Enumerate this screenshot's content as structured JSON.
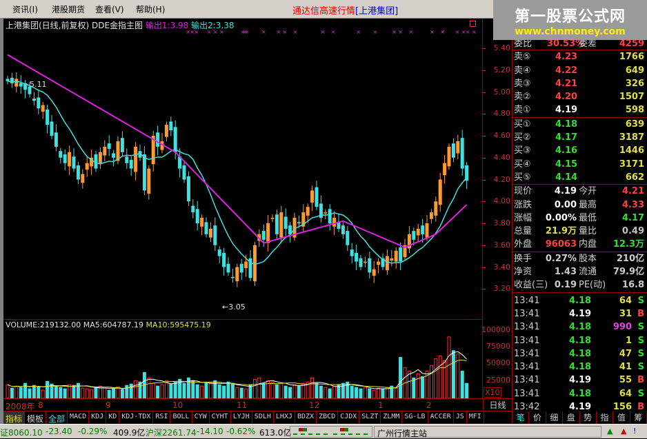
{
  "menu": {
    "items": [
      "资讯(I)",
      "港股期货",
      "查看(V)",
      "帮助(H)"
    ],
    "title": "通达信高速行情",
    "title_stock": "[上港集团]"
  },
  "logo": {
    "name": "第一股票公式网",
    "url": "www.chnmoney.com"
  },
  "chart_header": {
    "title": "上港集团(日线,前复权) DDE金指主图",
    "out1": "输出1:3.98",
    "out2": "输出2:3.38"
  },
  "annotations": {
    "high": "5.11",
    "low": "←3.05"
  },
  "volume_header": {
    "volume": "VOLUME:219132.00",
    "ma5": "MA5:604787.19",
    "ma10": "MA10:595475.19"
  },
  "volume_axis": [
    "100000",
    "75000",
    "50000",
    "25000"
  ],
  "volume_unit": "X10",
  "period": "日线",
  "date_labels": [
    "2008年",
    "8",
    "9",
    "10",
    "11",
    "12",
    "1",
    "2"
  ],
  "tabs": [
    "指标",
    "模板",
    "全部",
    "MACD",
    "KDJ",
    "KD",
    "KDJ-TDX",
    "RSI",
    "BOLL",
    "CYW",
    "CYHT",
    "LYJH",
    "SDLH",
    "LHXJ",
    "BDZX",
    "ZBCD",
    "CJDX",
    "SLZT",
    "ZLMM",
    "SG-LB",
    "ACCER",
    "JS",
    "MFI"
  ],
  "quote": {
    "wb": {
      "label": "委比",
      "value": "30.53%",
      "label2": "委差",
      "value2": "4259"
    },
    "sells": [
      {
        "label": "卖⑤",
        "price": "4.23",
        "vol": "1766"
      },
      {
        "label": "卖④",
        "price": "4.22",
        "vol": "649"
      },
      {
        "label": "卖③",
        "price": "4.21",
        "vol": "326"
      },
      {
        "label": "卖②",
        "price": "4.20",
        "vol": "1507"
      },
      {
        "label": "卖①",
        "price": "4.19",
        "vol": "598"
      }
    ],
    "buys": [
      {
        "label": "买①",
        "price": "4.18",
        "vol": "639"
      },
      {
        "label": "买②",
        "price": "4.17",
        "vol": "3187"
      },
      {
        "label": "买③",
        "price": "4.16",
        "vol": "1446"
      },
      {
        "label": "买④",
        "price": "4.15",
        "vol": "3171"
      },
      {
        "label": "买⑤",
        "price": "4.14",
        "vol": "662"
      }
    ],
    "stats": [
      {
        "l1": "现价",
        "v1": "4.19",
        "c1": "#ffffff",
        "l2": "今开",
        "v2": "4.21",
        "c2": "#ff4040"
      },
      {
        "l1": "涨跌",
        "v1": "0.00",
        "c1": "#ffffff",
        "l2": "最高",
        "v2": "4.33",
        "c2": "#ff4040"
      },
      {
        "l1": "涨幅",
        "v1": "0.00%",
        "c1": "#ffffff",
        "l2": "最低",
        "v2": "4.17",
        "c2": "#30e030"
      },
      {
        "l1": "总量",
        "v1": "21.9万",
        "c1": "#e0e040",
        "l2": "量比",
        "v2": "0.49",
        "c2": "#c0c0c0"
      },
      {
        "l1": "外盘",
        "v1": "96063",
        "c1": "#ff4040",
        "l2": "内盘",
        "v2": "12.3万",
        "c2": "#30e030"
      }
    ],
    "stats2": [
      {
        "l1": "换手",
        "v1": "0.27%",
        "l2": "股本",
        "v2": "210亿"
      },
      {
        "l1": "净资",
        "v1": "1.43",
        "l2": "流通",
        "v2": "79.9亿"
      },
      {
        "l1": "收益(三)",
        "v1": "0.19",
        "l2": "PE(动)",
        "v2": "16.8"
      }
    ]
  },
  "ticks": [
    {
      "time": "13:41",
      "price": "4.18",
      "vol": "64",
      "bs": "S",
      "pc": "#30e030",
      "vc": "#e0e040"
    },
    {
      "time": "13:41",
      "price": "4.19",
      "vol": "31",
      "bs": "B",
      "pc": "#ffffff",
      "vc": "#e0e040"
    },
    {
      "time": "13:41",
      "price": "4.18",
      "vol": "990",
      "bs": "S",
      "pc": "#30e030",
      "vc": "#e040e0"
    },
    {
      "time": "13:41",
      "price": "4.18",
      "vol": "1",
      "bs": "S",
      "pc": "#30e030",
      "vc": "#e0e040"
    },
    {
      "time": "13:41",
      "price": "4.18",
      "vol": "47",
      "bs": "S",
      "pc": "#30e030",
      "vc": "#e0e040"
    },
    {
      "time": "13:41",
      "price": "4.18",
      "vol": "41",
      "bs": "S",
      "pc": "#30e030",
      "vc": "#e0e040"
    },
    {
      "time": "13:41",
      "price": "4.19",
      "vol": "55",
      "bs": "B",
      "pc": "#ffffff",
      "vc": "#e0e040"
    },
    {
      "time": "13:41",
      "price": "4.18",
      "vol": "64",
      "bs": "S",
      "pc": "#30e030",
      "vc": "#e0e040"
    },
    {
      "time": "13:42",
      "price": "4.19",
      "vol": "156",
      "bs": "B",
      "pc": "#ffffff",
      "vc": "#e0e040"
    }
  ],
  "right_tabs": [
    "笔",
    "价",
    "细",
    "盘",
    "势",
    "指",
    "值",
    "筹"
  ],
  "status": {
    "idx1": "证8060.10",
    "idx1_chg": "-23.40",
    "idx1_pct": "-0.29%",
    "idx1_amt": "409.9亿",
    "idx2": "沪深2261.74",
    "idx2_chg": "-14.10",
    "idx2_pct": "-0.62%",
    "idx2_amt": "613.0亿",
    "server": "广州行情主站"
  },
  "colors": {
    "up": "#ff9a30",
    "down": "#40e0e0",
    "ma": "#40e0e0",
    "dde": "#e020e0",
    "axis": "#c03030"
  },
  "chart_data": {
    "type": "candlestick",
    "price_axis": [
      "5.40",
      "5.20",
      "5.00",
      "4.80",
      "4.60",
      "4.40",
      "4.20",
      "4.00",
      "3.80",
      "3.60",
      "3.40",
      "3.20"
    ],
    "ylim": [
      3.2,
      5.4
    ],
    "closes": [
      5.1,
      5.08,
      5.12,
      5.05,
      5.02,
      4.98,
      4.92,
      4.85,
      4.88,
      4.7,
      4.6,
      4.5,
      4.4,
      4.35,
      4.45,
      4.3,
      4.2,
      4.25,
      4.35,
      4.4,
      4.3,
      4.45,
      4.5,
      4.48,
      4.4,
      4.55,
      4.45,
      4.35,
      4.3,
      4.5,
      4.4,
      4.1,
      4.3,
      4.6,
      4.5,
      4.55,
      4.7,
      4.65,
      4.45,
      4.3,
      4.2,
      4.0,
      3.9,
      3.8,
      3.85,
      3.7,
      3.75,
      3.6,
      3.5,
      3.4,
      3.35,
      3.3,
      3.4,
      3.35,
      3.45,
      3.3,
      3.6,
      3.7,
      3.65,
      3.8,
      3.85,
      3.7,
      3.9,
      3.75,
      3.7,
      3.85,
      3.8,
      3.9,
      3.95,
      4.1,
      3.95,
      3.85,
      3.9,
      3.8,
      3.85,
      3.75,
      3.7,
      3.6,
      3.5,
      3.45,
      3.4,
      3.45,
      3.35,
      3.38,
      3.45,
      3.4,
      3.5,
      3.48,
      3.55,
      3.45,
      3.6,
      3.7,
      3.65,
      3.75,
      3.7,
      3.8,
      3.9,
      4.0,
      4.2,
      4.35,
      4.5,
      4.4,
      4.55,
      4.3,
      4.19
    ],
    "volumes": [
      20000,
      15000,
      18000,
      16000,
      22000,
      14000,
      19000,
      17000,
      12000,
      25000,
      21000,
      18000,
      16000,
      14000,
      20000,
      19000,
      22000,
      15000,
      14000,
      13000,
      16000,
      18000,
      15000,
      12000,
      14000,
      17000,
      13000,
      19000,
      21000,
      26000,
      24000,
      38000,
      30000,
      22000,
      18000,
      20000,
      26000,
      21000,
      24000,
      28000,
      22000,
      30000,
      26000,
      20000,
      18000,
      22000,
      24000,
      26000,
      20000,
      18000,
      24000,
      22000,
      16000,
      15000,
      14000,
      20000,
      28000,
      30000,
      22000,
      26000,
      24000,
      20000,
      22000,
      18000,
      16000,
      20000,
      18000,
      22000,
      24000,
      30000,
      22000,
      18000,
      16000,
      14000,
      18000,
      20000,
      22000,
      24000,
      18000,
      16000,
      14000,
      16000,
      14000,
      12000,
      15000,
      14000,
      16000,
      18000,
      15000,
      60000,
      45000,
      40000,
      30000,
      36000,
      32000,
      40000,
      48000,
      58000,
      62000,
      55000,
      90000,
      70000,
      65000,
      40000,
      22000
    ],
    "dde_line": [
      [
        0,
        5.34
      ],
      [
        38,
        4.45
      ],
      [
        58,
        3.62
      ],
      [
        76,
        3.82
      ],
      [
        90,
        3.58
      ],
      [
        97,
        3.7
      ],
      [
        104,
        3.97
      ]
    ],
    "signal_indices": [
      44,
      46,
      48,
      54,
      57,
      60,
      70,
      71,
      72,
      80,
      87,
      90,
      95,
      108,
      113,
      125,
      133,
      142,
      145,
      150,
      160,
      165,
      172,
      175,
      177,
      180
    ]
  }
}
